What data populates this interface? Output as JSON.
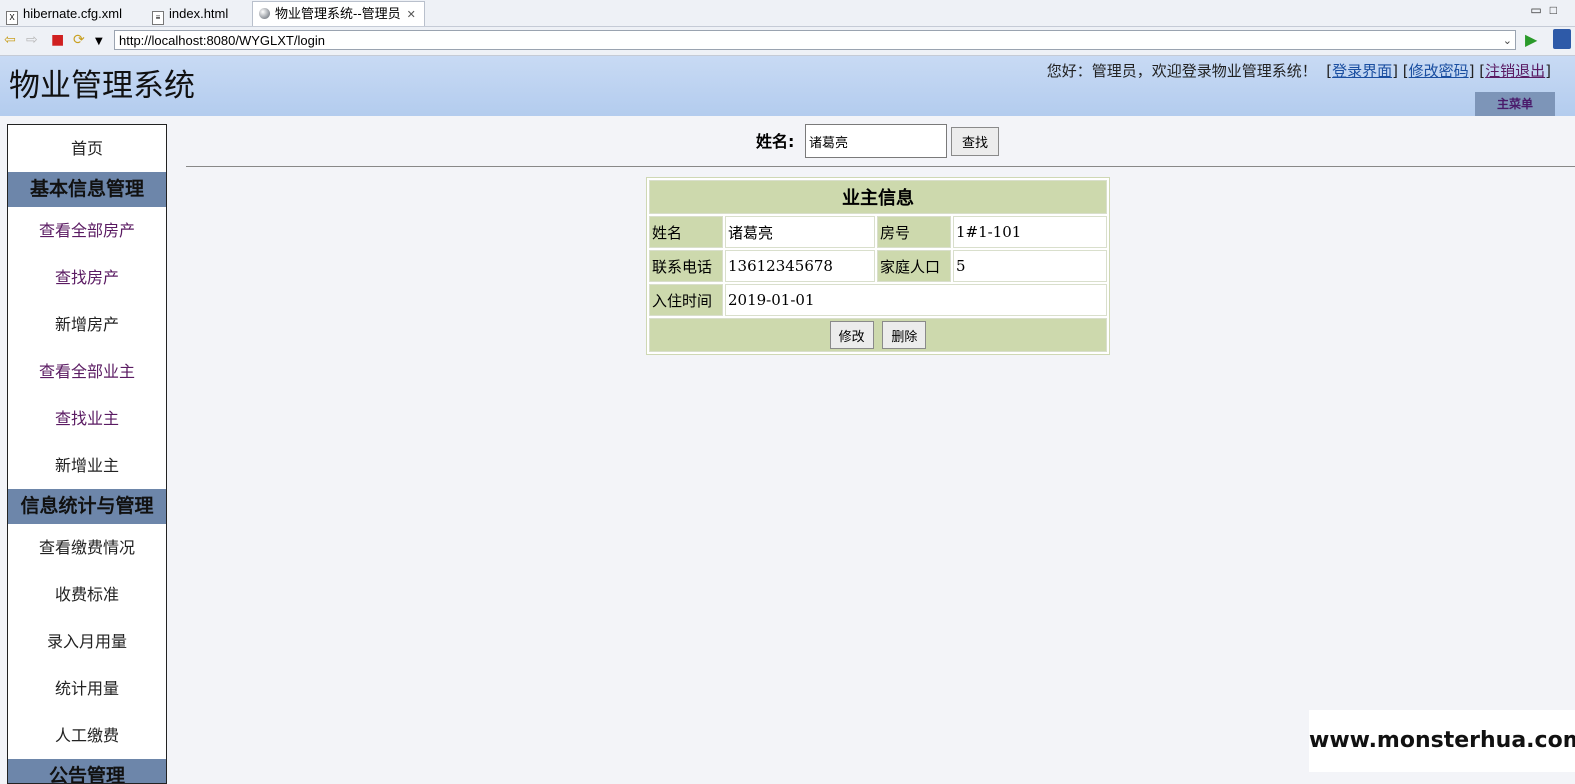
{
  "ide_tabs": [
    {
      "label": "hibernate.cfg.xml",
      "icon": "xml-file-icon"
    },
    {
      "label": "index.html",
      "icon": "html-file-icon"
    },
    {
      "label": "物业管理系统--管理员",
      "icon": "globe-icon",
      "active": true
    }
  ],
  "browser": {
    "url": "http://localhost:8080/WYGLXT/login"
  },
  "header": {
    "title": "物业管理系统",
    "welcome_text": "您好：管理员，欢迎登录物业管理系统！",
    "links": [
      "登录界面",
      "修改密码",
      "注销退出"
    ],
    "main_menu_button": "主菜单"
  },
  "sidebar": {
    "home": "首页",
    "sections": [
      {
        "heading": "基本信息管理",
        "items": [
          "查看全部房产",
          "查找房产",
          "新增房产",
          "查看全部业主",
          "查找业主",
          "新增业主"
        ]
      },
      {
        "heading": "信息统计与管理",
        "items": [
          "查看缴费情况",
          "收费标准",
          "录入月用量",
          "统计用量",
          "人工缴费"
        ]
      },
      {
        "heading": "公告管理",
        "items": []
      }
    ]
  },
  "search": {
    "label": "姓名:",
    "value": "诸葛亮",
    "button": "查找"
  },
  "owner_info": {
    "caption": "业主信息",
    "name_label": "姓名",
    "name_value": "诸葛亮",
    "room_label": "房号",
    "room_value": "1#1-101",
    "phone_label": "联系电话",
    "phone_value": "13612345678",
    "family_label": "家庭人口",
    "family_value": "5",
    "checkin_label": "入住时间",
    "checkin_value": "2019-01-01",
    "edit_button": "修改",
    "delete_button": "删除"
  },
  "watermark": "www.monsterhua.com",
  "colors": {
    "header_bg": "#bcd2f0",
    "sidebar_heading_bg": "#6d86aa",
    "table_label_bg": "#cdd9ad",
    "link": "#1a4ea0",
    "visited_link": "#5a1a62"
  }
}
